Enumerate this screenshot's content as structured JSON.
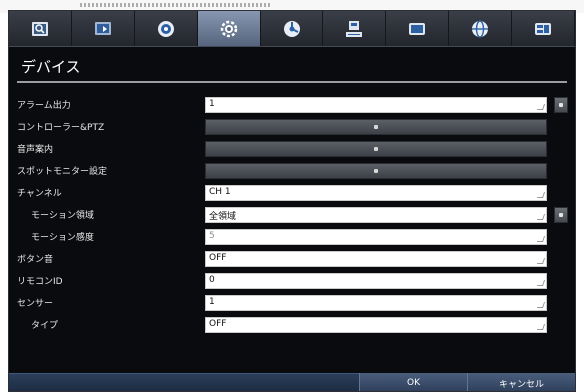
{
  "tabs": [
    {
      "icon": "camera-search-icon",
      "active": false
    },
    {
      "icon": "display-icon",
      "active": false
    },
    {
      "icon": "record-disc-icon",
      "active": false
    },
    {
      "icon": "device-settings-icon",
      "active": true
    },
    {
      "icon": "network-schedule-icon",
      "active": false
    },
    {
      "icon": "storage-icon",
      "active": false
    },
    {
      "icon": "screen-icon",
      "active": false
    },
    {
      "icon": "globe-icon",
      "active": false
    },
    {
      "icon": "system-info-icon",
      "active": false
    }
  ],
  "page": {
    "title": "デバイス"
  },
  "rows": {
    "alarm_output": {
      "label": "アラーム出力",
      "value": "1"
    },
    "controller_ptz": {
      "label": "コントローラー&PTZ"
    },
    "audio_guide": {
      "label": "音声案内"
    },
    "spot_monitor": {
      "label": "スポットモニター設定"
    },
    "channel": {
      "label": "チャンネル",
      "value": "CH 1"
    },
    "motion_area": {
      "label": "モーション領域",
      "value": "全領域"
    },
    "motion_sensitivity": {
      "label": "モーション感度",
      "value": "5"
    },
    "button_sound": {
      "label": "ボタン音",
      "value": "OFF"
    },
    "remote_id": {
      "label": "リモコンID",
      "value": "0"
    },
    "sensor": {
      "label": "センサー",
      "value": "1"
    },
    "type": {
      "label": "タイプ",
      "value": "OFF"
    }
  },
  "footer": {
    "ok": "OK",
    "cancel": "キャンセル"
  },
  "colors": {
    "accent_tab": "#6f7f99",
    "background": "#0a0b0e",
    "footer": "#2c3f5a"
  }
}
